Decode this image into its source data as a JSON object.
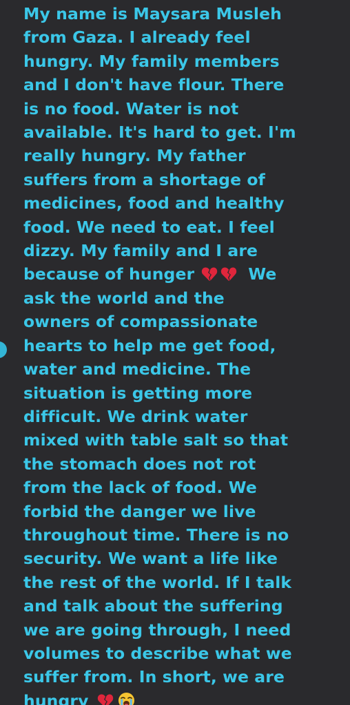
{
  "message": {
    "lines": [
      "My name is Maysara Musleh",
      "from Gaza. I already feel",
      "hungry. My family members",
      "and I don't have flour. There",
      "is no food. Water is not",
      "available. It's hard to get. I'm",
      "really hungry. My father",
      "suffers from a shortage of",
      "medicines, food and healthy",
      "food. We need to eat. I feel",
      "dizzy. My family and I are",
      "because of hunger",
      "We",
      "ask the world and the",
      "owners of compassionate",
      "hearts to help me get food,",
      "water and medicine. The",
      "situation is getting more",
      "difficult. We drink water",
      "mixed with table salt so that",
      "the stomach does not rot",
      "from the lack of food. We",
      "forbid the danger we live",
      "throughout time. There is no",
      "security. We want a life like",
      "the rest of the world. If I talk",
      "and talk about the suffering",
      "we are going through, I need",
      "volumes to describe what we",
      "suffer from. In short, we are",
      "hungry"
    ],
    "emojis": {
      "broken_heart": "broken-heart-icon",
      "crying_face": "loudly-crying-face-icon"
    }
  },
  "colors": {
    "background": "#1c1c1e",
    "bubble": "#2a2a2d",
    "text": "#3bc7e8",
    "heart": "#e0263c",
    "face": "#f7c531",
    "tears": "#5ab8f0",
    "edge_handle": "#33b5d6"
  }
}
